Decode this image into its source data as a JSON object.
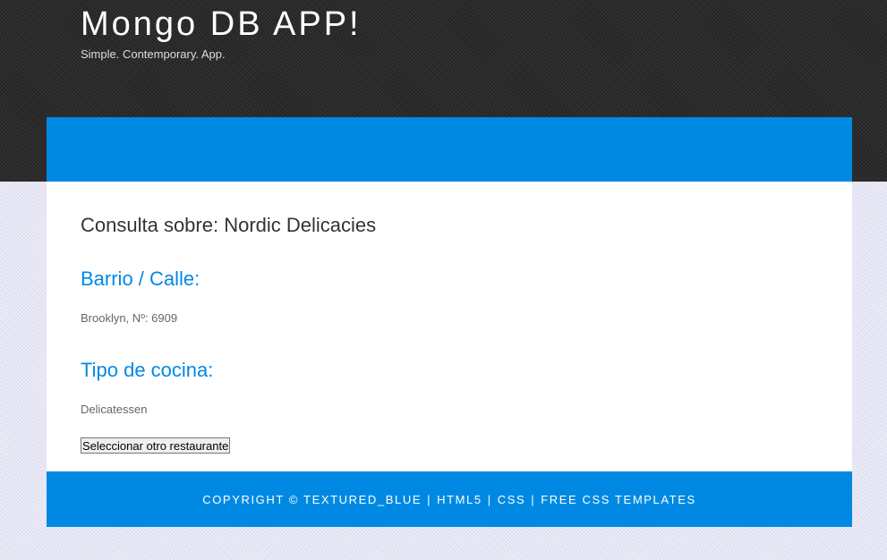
{
  "header": {
    "title": "Mongo DB APP!",
    "tagline": "Simple. Contemporary. App."
  },
  "main": {
    "heading": "Consulta sobre: Nordic Delicacies",
    "sections": [
      {
        "heading": "Barrio / Calle:",
        "text": "Brooklyn, Nº: 6909"
      },
      {
        "heading": "Tipo de cocina:",
        "text": "Delicatessen"
      }
    ],
    "button_label": "Seleccionar otro restaurante"
  },
  "footer": {
    "copyright": "COPYRIGHT © TEXTURED_BLUE",
    "separator": "|",
    "links": [
      "HTML5",
      "CSS",
      "FREE CSS TEMPLATES"
    ]
  },
  "colors": {
    "accent": "#0089e3",
    "header_bg": "#2b2b2b",
    "body_bg": "#eeeef8"
  }
}
